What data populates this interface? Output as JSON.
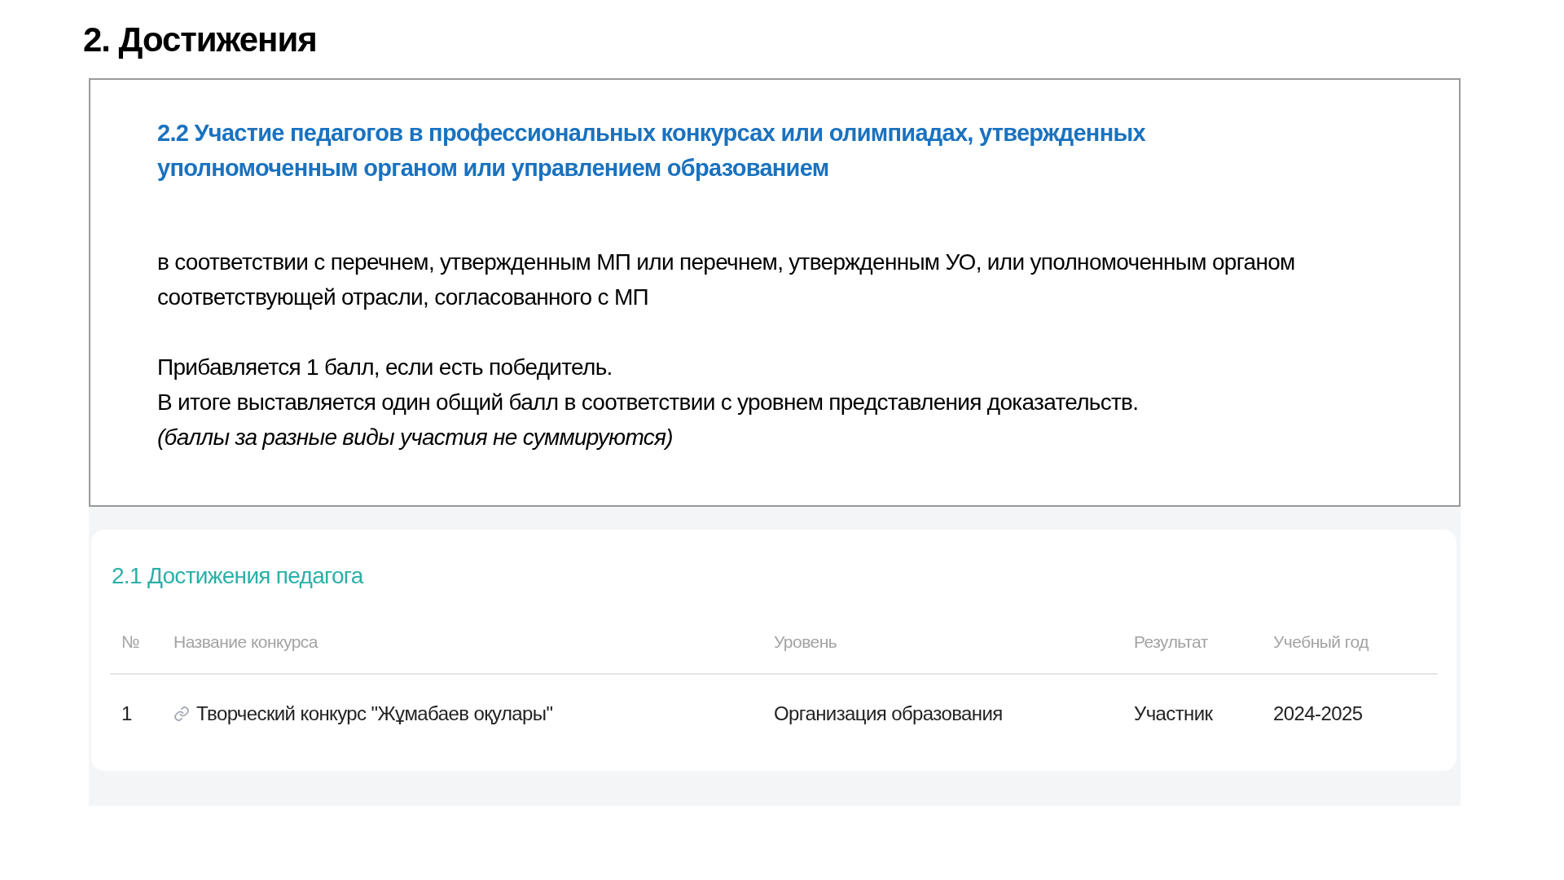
{
  "slide_title": "2. Достижения",
  "criterion": {
    "title": "2.2 Участие педагогов в профессиональных конкурсах или олимпиадах, утвержденных уполномоченным органом или управлением образованием",
    "paragraphs": [
      {
        "kind": "plain",
        "text": "в соответствии с перечнем, утвержденным МП или перечнем, утвержденным УО, или уполномоченным органом соответствующей отрасли, согласованного с МП"
      },
      {
        "kind": "gap"
      },
      {
        "kind": "plain",
        "text": "Прибавляется 1 балл, если есть победитель."
      },
      {
        "kind": "plain",
        "text": "В итоге выставляется один общий балл в соответствии с уровнем представления доказательств."
      },
      {
        "kind": "italic",
        "text": "(баллы за разные виды участия не суммируются)"
      }
    ]
  },
  "screenshot": {
    "title": "2.1 Достижения педагога",
    "table": {
      "columns": [
        "№",
        "Название конкурса",
        "Уровень",
        "Результат",
        "Учебный год"
      ],
      "rows": [
        {
          "cells": [
            "1",
            "Творческий конкурс \"Жұмабаев оқулары\"",
            "Организация образования",
            "Участник",
            "2024-2025"
          ],
          "linked": true
        }
      ]
    }
  }
}
